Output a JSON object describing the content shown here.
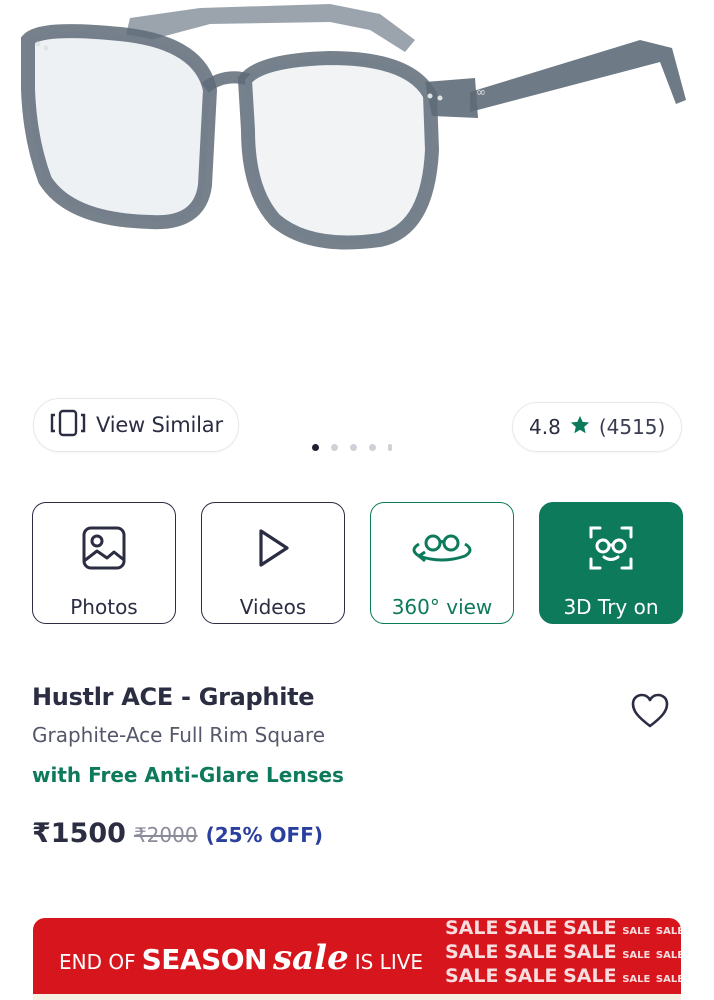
{
  "product": {
    "title": "Hustlr ACE - Graphite",
    "subtitle": "Graphite-Ace Full Rim Square",
    "offer": "with Free Anti-Glare Lenses",
    "price": "₹1500",
    "original_price": "₹2000",
    "discount": "(25% OFF)",
    "frame_color": "#5e6b78"
  },
  "actions": {
    "view_similar": "View Similar",
    "rating": "4.8",
    "reviews": "(4515)",
    "star_color": "#0e7a5c"
  },
  "carousel": {
    "total_dots": 5,
    "active_index": 0
  },
  "media_buttons": [
    {
      "label": "Photos",
      "icon": "image-icon"
    },
    {
      "label": "Videos",
      "icon": "play-icon"
    },
    {
      "label": "360° view",
      "icon": "rotate-360-icon"
    },
    {
      "label": "3D Try on",
      "icon": "face-glasses-icon"
    }
  ],
  "banner": {
    "prefix": "END OF",
    "season": "SEASON",
    "sale": "sale",
    "suffix": "IS LIVE",
    "sale_word": "SALE",
    "background": "#d7151d"
  },
  "colors": {
    "primary_text": "#2b2d42",
    "accent_teal": "#0e7a5c",
    "discount_blue": "#2a3f9e"
  }
}
